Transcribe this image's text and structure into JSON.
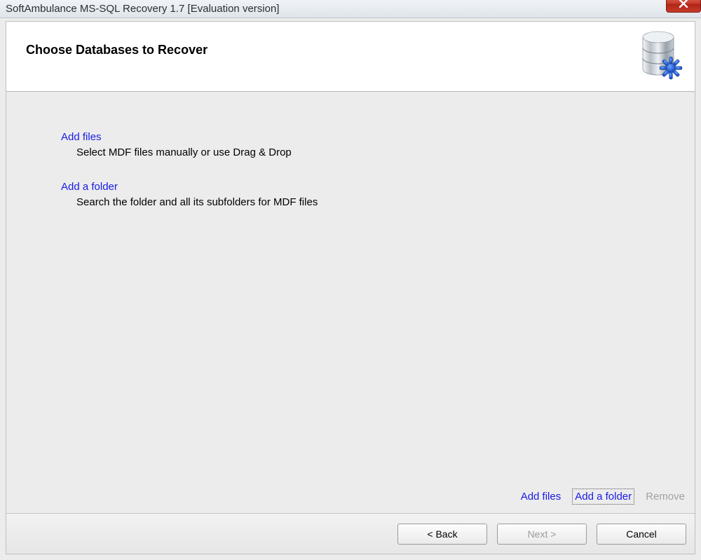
{
  "window": {
    "title": "SoftAmbulance MS-SQL Recovery 1.7 [Evaluation version]"
  },
  "header": {
    "title": "Choose Databases to Recover"
  },
  "options": [
    {
      "link_label": "Add files",
      "description": "Select MDF files manually or use Drag & Drop"
    },
    {
      "link_label": "Add a folder",
      "description": "Search the folder and all its subfolders for MDF files"
    }
  ],
  "action_links": {
    "add_files": "Add files",
    "add_folder": "Add a folder",
    "remove": "Remove"
  },
  "buttons": {
    "back": "< Back",
    "next": "Next >",
    "cancel": "Cancel"
  }
}
